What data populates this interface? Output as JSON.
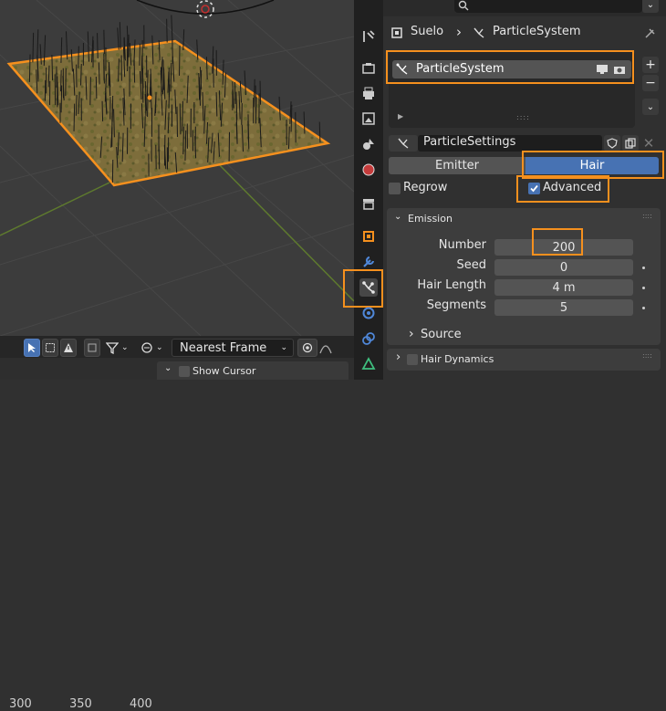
{
  "viewport": {
    "toolbar": {
      "snap_dropdown_value": "Nearest Frame",
      "show_cursor_label": "Show Cursor"
    },
    "ruler_ticks": [
      "300",
      "350",
      "400"
    ]
  },
  "properties": {
    "breadcrumb": {
      "object": "Suelo",
      "item": "ParticleSystem"
    },
    "list": {
      "items": [
        "ParticleSystem"
      ]
    },
    "settings_name": "ParticleSettings",
    "type_tabs": [
      "Emitter",
      "Hair"
    ],
    "active_type": "Hair",
    "regrow_label": "Regrow",
    "advanced_label": "Advanced",
    "emission": {
      "title": "Emission",
      "fields": [
        {
          "label": "Number",
          "value": "200"
        },
        {
          "label": "Seed",
          "value": "0"
        },
        {
          "label": "Hair Length",
          "value": "4 m"
        },
        {
          "label": "Segments",
          "value": "5"
        }
      ]
    },
    "source_label": "Source",
    "hair_dynamics_label": "Hair Dynamics"
  },
  "colors": {
    "highlight": "#f5901e",
    "accent": "#4772b3"
  }
}
